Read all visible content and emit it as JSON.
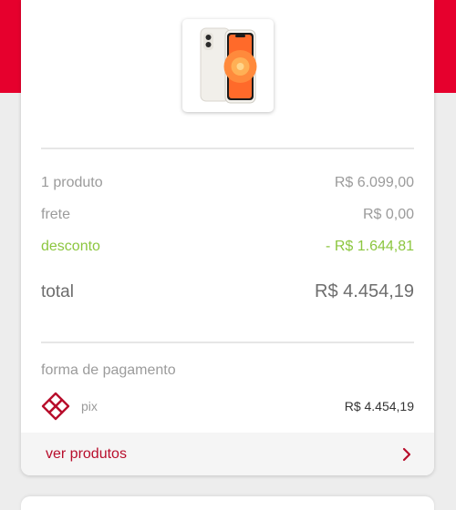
{
  "summary": {
    "product_count_label": "1 produto",
    "product_price": "R$ 6.099,00",
    "shipping_label": "frete",
    "shipping_price": "R$ 0,00",
    "discount_label": "desconto",
    "discount_value": "- R$ 1.644,81",
    "total_label": "total",
    "total_value": "R$ 4.454,19"
  },
  "payment": {
    "section_label": "forma de pagamento",
    "method": "pix",
    "method_icon": "pix-icon",
    "amount": "R$ 4.454,19"
  },
  "footer": {
    "link_label": "ver produtos",
    "icon": "chevron-right-icon"
  },
  "colors": {
    "brand_red": "#e6002d",
    "link_red": "#b80e2c",
    "discount_green": "#8cc63f",
    "muted_text": "#9b9b9b"
  }
}
